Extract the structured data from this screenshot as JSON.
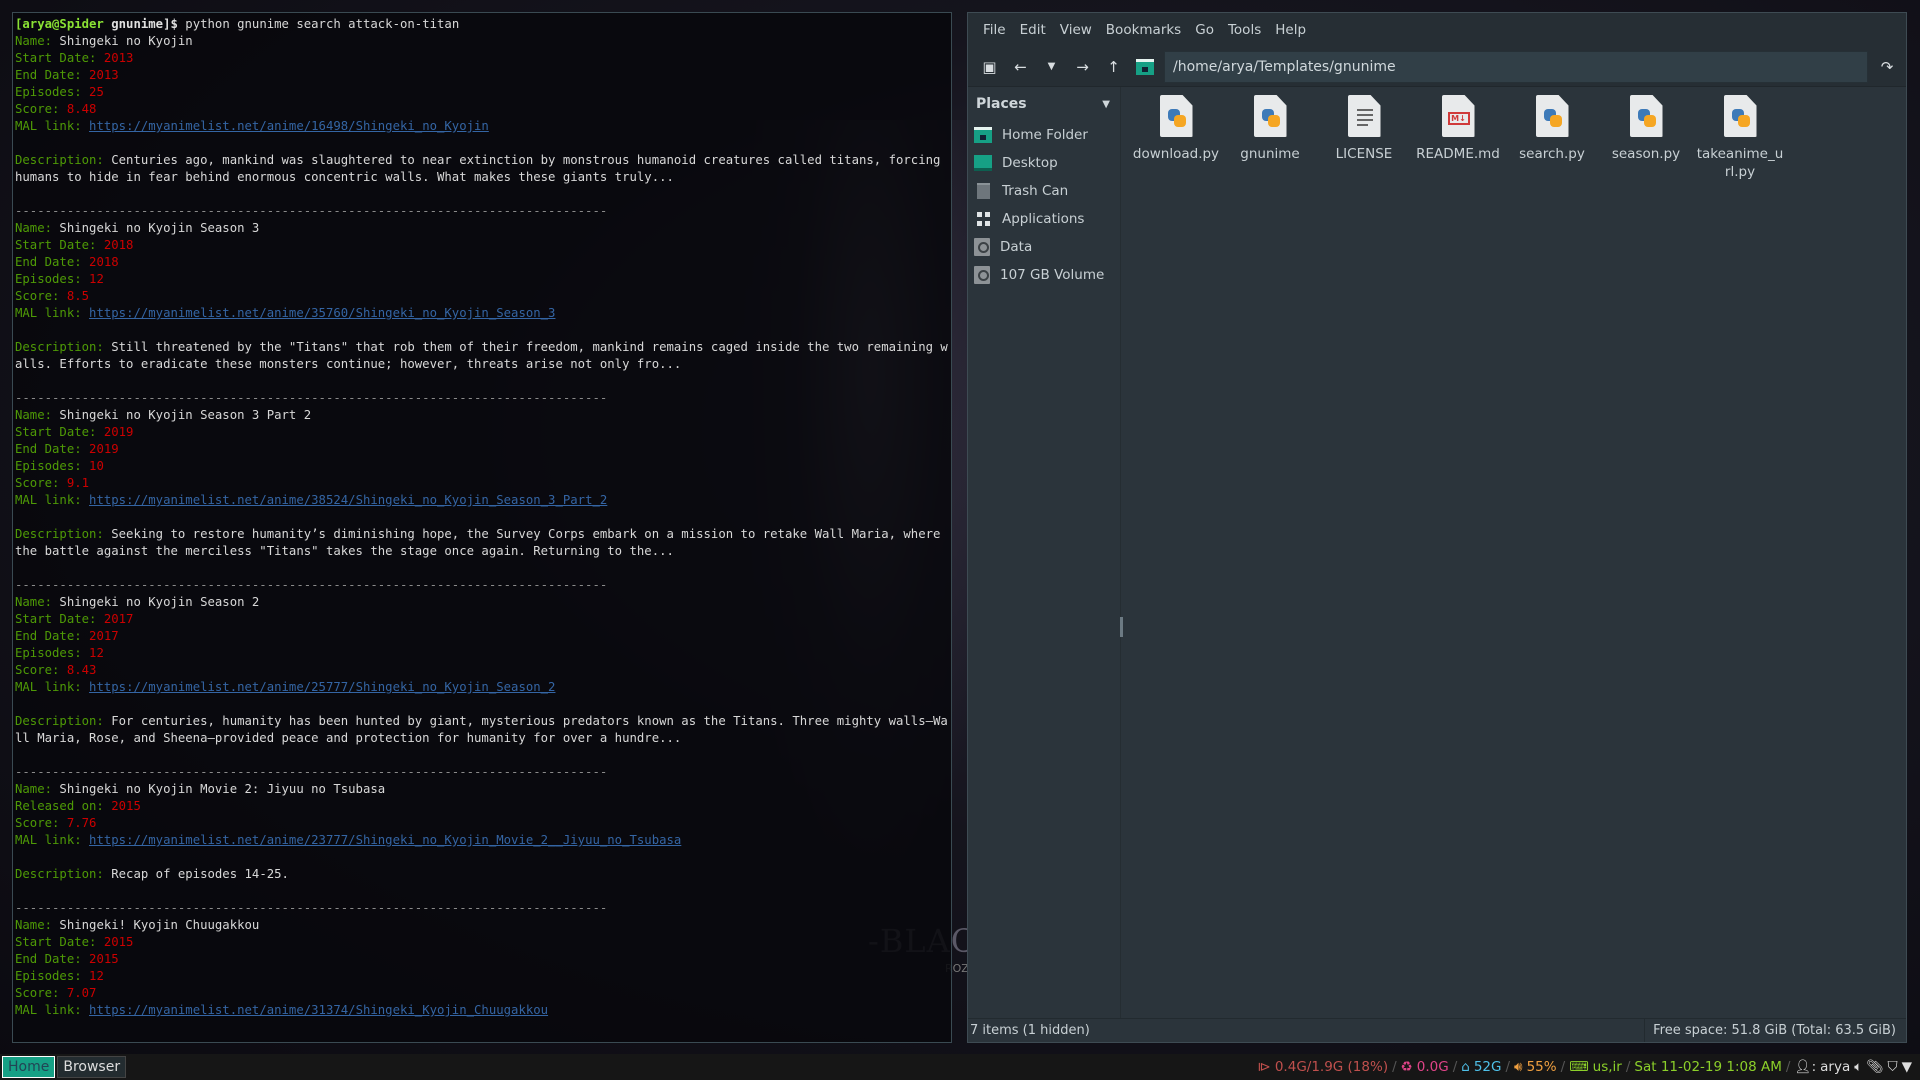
{
  "terminal": {
    "prompt_user": "[arya@Spider",
    "prompt_dir": "gnunime]$",
    "command": "python gnunime search attack-on-titan",
    "separator": "--------------------------------------------------------------------------------",
    "labels": {
      "name": "Name: ",
      "start": "Start Date: ",
      "end": "End Date: ",
      "episodes": "Episodes: ",
      "score": "Score: ",
      "mal": "MAL link: ",
      "desc": "Description:  ",
      "released": "Released on: "
    },
    "results": [
      {
        "name": "Shingeki no Kyojin",
        "start": "2013",
        "end": "2013",
        "episodes": "25",
        "score": "8.48",
        "mal": "https://myanimelist.net/anime/16498/Shingeki_no_Kyojin",
        "desc": "Centuries ago, mankind was slaughtered to near extinction by monstrous humanoid creatures called titans, forcing humans to hide in fear behind enormous concentric walls. What makes these giants truly..."
      },
      {
        "name": "Shingeki no Kyojin Season 3",
        "start": "2018",
        "end": "2018",
        "episodes": "12",
        "score": "8.5",
        "mal": "https://myanimelist.net/anime/35760/Shingeki_no_Kyojin_Season_3",
        "desc": "Still threatened by the \"Titans\" that rob them of their freedom, mankind remains caged inside the two remaining walls. Efforts to eradicate these monsters continue; however, threats arise not only fro..."
      },
      {
        "name": "Shingeki no Kyojin Season 3 Part 2",
        "start": "2019",
        "end": "2019",
        "episodes": "10",
        "score": "9.1",
        "mal": "https://myanimelist.net/anime/38524/Shingeki_no_Kyojin_Season_3_Part_2",
        "desc": "Seeking to restore humanity’s diminishing hope, the Survey Corps embark on a mission to retake Wall Maria, where the battle against the merciless \"Titans\" takes the stage once again. Returning to the..."
      },
      {
        "name": "Shingeki no Kyojin Season 2",
        "start": "2017",
        "end": "2017",
        "episodes": "12",
        "score": "8.43",
        "mal": "https://myanimelist.net/anime/25777/Shingeki_no_Kyojin_Season_2",
        "desc": "For centuries, humanity has been hunted by giant, mysterious predators known as the Titans. Three mighty walls—Wall Maria, Rose, and Sheena—provided peace and protection for humanity for over a hundre..."
      },
      {
        "name": "Shingeki no Kyojin Movie 2: Jiyuu no Tsubasa",
        "released": "2015",
        "score": "7.76",
        "mal": "https://myanimelist.net/anime/23777/Shingeki_no_Kyojin_Movie_2__Jiyuu_no_Tsubasa",
        "desc": "Recap of episodes 14-25."
      },
      {
        "name": "Shingeki! Kyojin Chuugakkou",
        "start": "2015",
        "end": "2015",
        "episodes": "12",
        "score": "7.07",
        "mal": "https://myanimelist.net/anime/31374/Shingeki_Kyojin_Chuugakkou"
      }
    ]
  },
  "wallpaper": {
    "title": "-BLACK",
    "sub": "ROZ"
  },
  "file_manager": {
    "menu": [
      "File",
      "Edit",
      "View",
      "Bookmarks",
      "Go",
      "Tools",
      "Help"
    ],
    "path": "/home/arya/Templates/gnunime",
    "places_label": "Places",
    "places": [
      {
        "label": "Home Folder",
        "icon": "home-folder-icon"
      },
      {
        "label": "Desktop",
        "icon": "desktop-icon"
      },
      {
        "label": "Trash Can",
        "icon": "trash-icon"
      },
      {
        "label": "Applications",
        "icon": "applications-icon"
      },
      {
        "label": "Data",
        "icon": "drive-icon"
      },
      {
        "label": "107 GB Volume",
        "icon": "drive-icon"
      }
    ],
    "files": [
      {
        "name": "download.py",
        "type": "python"
      },
      {
        "name": "gnunime",
        "type": "python"
      },
      {
        "name": "LICENSE",
        "type": "text"
      },
      {
        "name": "README.md",
        "type": "markdown"
      },
      {
        "name": "search.py",
        "type": "python"
      },
      {
        "name": "season.py",
        "type": "python"
      },
      {
        "name": "takeanime_url.py",
        "type": "python"
      }
    ],
    "status_left": "7 items (1 hidden)",
    "status_right": "Free space: 51.8 GiB (Total: 63.5 GiB)"
  },
  "panel": {
    "workspaces": [
      {
        "label": "Home",
        "active": true
      },
      {
        "label": "Browser",
        "active": false
      }
    ],
    "memory": "0.4G/1.9G (18%)",
    "swap": "0.0G",
    "disk": "52G",
    "volume": "55%",
    "keyboard": "us,ir",
    "datetime": "Sat 11-02-19  1:08 AM",
    "user": "arya"
  }
}
